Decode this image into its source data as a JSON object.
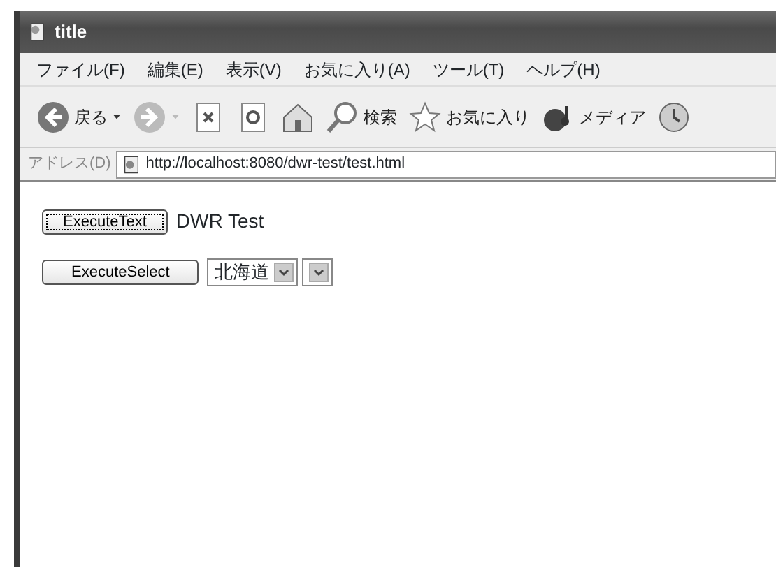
{
  "window": {
    "title": "title"
  },
  "menu": [
    "ファイル(F)",
    "編集(E)",
    "表示(V)",
    "お気に入り(A)",
    "ツール(T)",
    "ヘルプ(H)"
  ],
  "toolbar": [
    {
      "kind": "back",
      "label": "戻る"
    },
    {
      "kind": "forward"
    },
    {
      "kind": "stop"
    },
    {
      "kind": "refresh"
    },
    {
      "kind": "home"
    },
    {
      "kind": "search",
      "label": "検索"
    },
    {
      "kind": "favorites",
      "label": "お気に入り"
    },
    {
      "kind": "media",
      "label": "メディア"
    },
    {
      "kind": "history"
    }
  ],
  "address": {
    "label": "アドレス(D)",
    "url": "http://localhost:8080/dwr-test/test.html"
  },
  "content": {
    "text_button": {
      "label": "ExecuteText",
      "focused": true
    },
    "output": "DWR Test",
    "select_button": {
      "label": "ExecuteSelect",
      "focused": false
    },
    "selects": [
      {
        "kind": "dropdown",
        "value": "北海道"
      },
      {
        "kind": "dropdown"
      }
    ]
  }
}
